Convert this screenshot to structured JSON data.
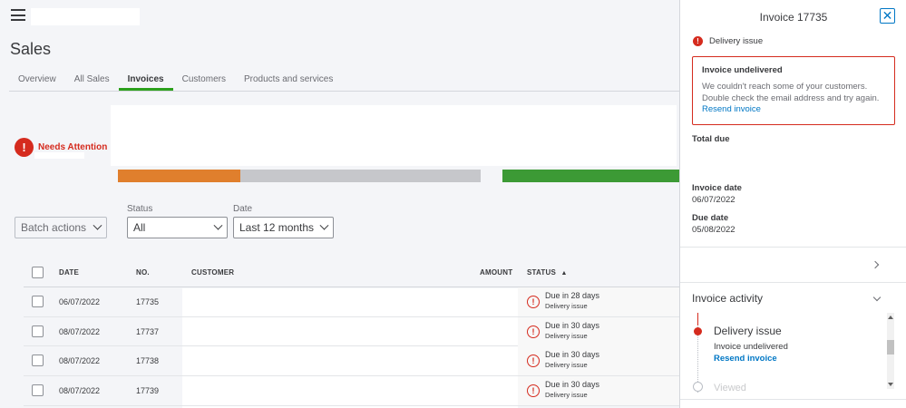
{
  "header": {
    "menu_icon": "hamburger-menu-icon"
  },
  "page": {
    "title": "Sales"
  },
  "tabs": [
    {
      "label": "Overview"
    },
    {
      "label": "All Sales"
    },
    {
      "label": "Invoices",
      "active": true
    },
    {
      "label": "Customers"
    },
    {
      "label": "Products and services"
    }
  ],
  "attention": {
    "icon": "!",
    "label": "Needs Attention"
  },
  "colors": {
    "overdue": "#e07f2d",
    "not_due": "#c6c7cb",
    "paid": "#3c9a35",
    "accent": "#2ca01c",
    "error": "#d52b1e",
    "link": "#0077c5"
  },
  "filters": {
    "batch_label": "Batch actions",
    "status_label": "Status",
    "status_value": "All",
    "date_label": "Date",
    "date_value": "Last 12 months"
  },
  "table": {
    "columns": {
      "date": "DATE",
      "no": "NO.",
      "customer": "CUSTOMER",
      "amount": "AMOUNT",
      "status": "STATUS",
      "sort_indicator": "▲"
    },
    "rows": [
      {
        "date": "06/07/2022",
        "no": "17735",
        "status": "Due in 28 days",
        "sub": "Delivery issue"
      },
      {
        "date": "08/07/2022",
        "no": "17737",
        "status": "Due in 30 days",
        "sub": "Delivery issue"
      },
      {
        "date": "08/07/2022",
        "no": "17738",
        "status": "Due in 30 days",
        "sub": "Delivery issue"
      },
      {
        "date": "08/07/2022",
        "no": "17739",
        "status": "Due in 30 days",
        "sub": "Delivery issue"
      }
    ]
  },
  "drawer": {
    "title": "Invoice 17735",
    "close": "✕",
    "issue_label": "Delivery issue",
    "error_title": "Invoice undelivered",
    "error_text": "We couldn't reach some of your customers. Double check the email address and try again.",
    "error_link": "Resend invoice",
    "total_due_label": "Total due",
    "invoice_date_label": "Invoice date",
    "invoice_date": "06/07/2022",
    "due_date_label": "Due date",
    "due_date": "05/08/2022",
    "activity_title": "Invoice activity",
    "event_title": "Delivery issue",
    "event_sub": "Invoice undelivered",
    "event_link": "Resend invoice",
    "event2_title": "Viewed"
  }
}
